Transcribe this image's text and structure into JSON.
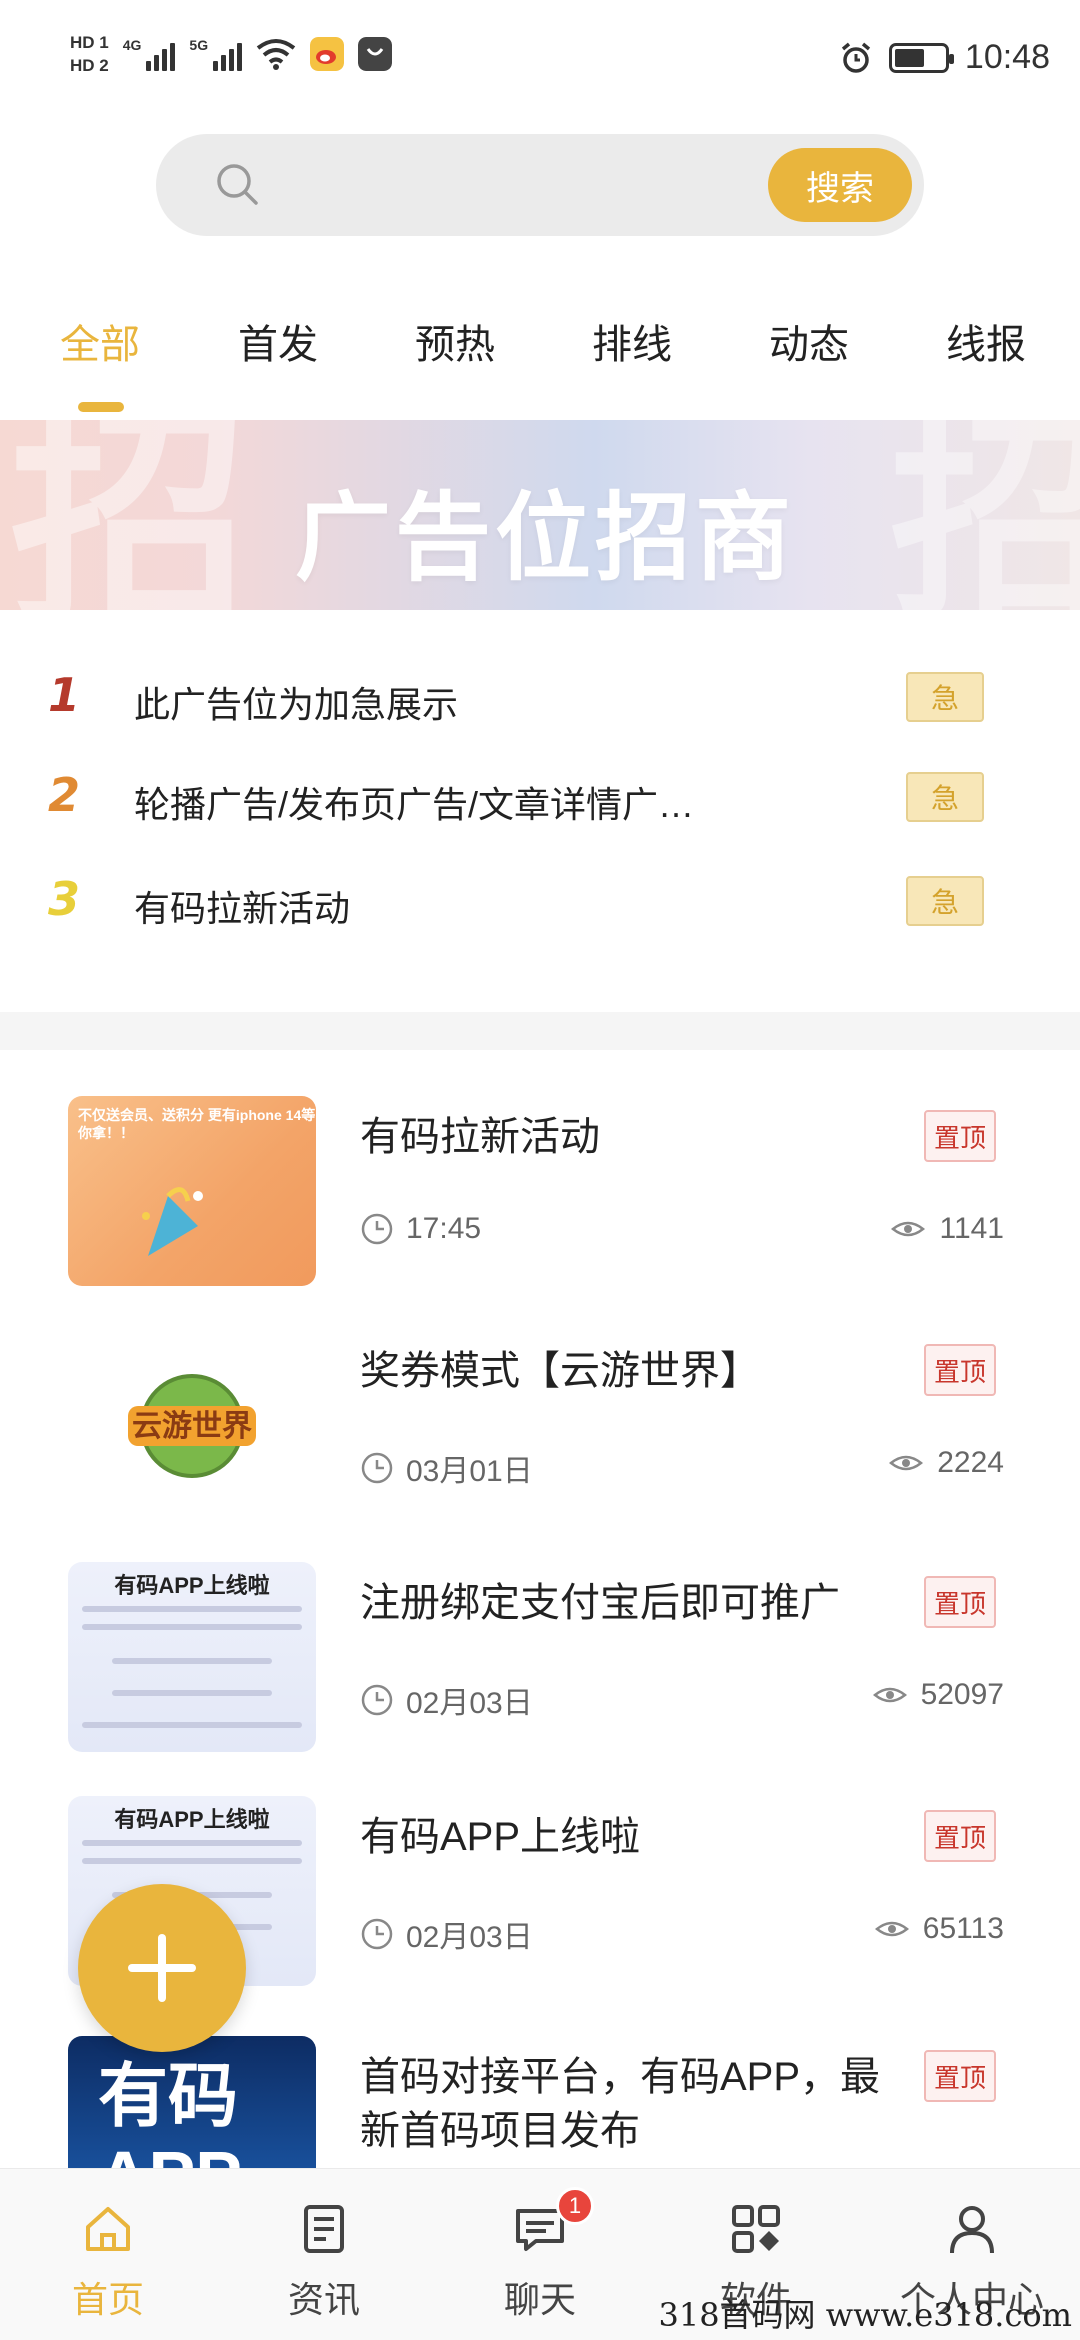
{
  "status_bar": {
    "sim1": "HD 1",
    "sim2": "HD 2",
    "net1": "4G",
    "net2": "5G",
    "time": "10:48"
  },
  "search": {
    "placeholder": "",
    "button_label": "搜索"
  },
  "tabs": [
    {
      "label": "全部",
      "active": true
    },
    {
      "label": "首发",
      "active": false
    },
    {
      "label": "预热",
      "active": false
    },
    {
      "label": "排线",
      "active": false
    },
    {
      "label": "动态",
      "active": false
    },
    {
      "label": "线报",
      "active": false
    }
  ],
  "banner": {
    "title": "广告位招商"
  },
  "urgent": {
    "badge_label": "急",
    "items": [
      {
        "num": "1",
        "text": "此广告位为加急展示"
      },
      {
        "num": "2",
        "text": "轮播广告/发布页广告/文章详情广…"
      },
      {
        "num": "3",
        "text": "有码拉新活动"
      }
    ]
  },
  "news": {
    "badge_label": "置顶",
    "items": [
      {
        "title": "有码拉新活动",
        "date": "17:45",
        "views": "1141",
        "thumb_text": "不仅送会员、送积分 更有iphone 14等你拿！！"
      },
      {
        "title": "奖券模式【云游世界】",
        "date": "03月01日",
        "views": "2224",
        "thumb_text": "云游世界"
      },
      {
        "title": "注册绑定支付宝后即可推广",
        "date": "02月03日",
        "views": "52097",
        "thumb_text": "有码APP上线啦"
      },
      {
        "title": "有码APP上线啦",
        "date": "02月03日",
        "views": "65113",
        "thumb_text": "有码APP上线啦"
      },
      {
        "title": "首码对接平台，有码APP，最新首码项目发布",
        "date": "",
        "views": "",
        "thumb_text": "有码 APP"
      }
    ]
  },
  "bottom_nav": [
    {
      "label": "首页",
      "icon": "home-icon",
      "active": true
    },
    {
      "label": "资讯",
      "icon": "news-icon",
      "active": false
    },
    {
      "label": "聊天",
      "icon": "chat-icon",
      "active": false,
      "badge": "1"
    },
    {
      "label": "软件",
      "icon": "apps-icon",
      "active": false
    },
    {
      "label": "个人中心",
      "icon": "person-icon",
      "active": false
    }
  ],
  "watermark": "318首码网  www.e318.com",
  "colors": {
    "accent": "#e9b53d",
    "pin_red": "#c8362c",
    "urgent_badge_bg": "#f8e7b8",
    "num1": "#b53a2c",
    "num2": "#e08a33",
    "num3": "#e8cf3a"
  }
}
